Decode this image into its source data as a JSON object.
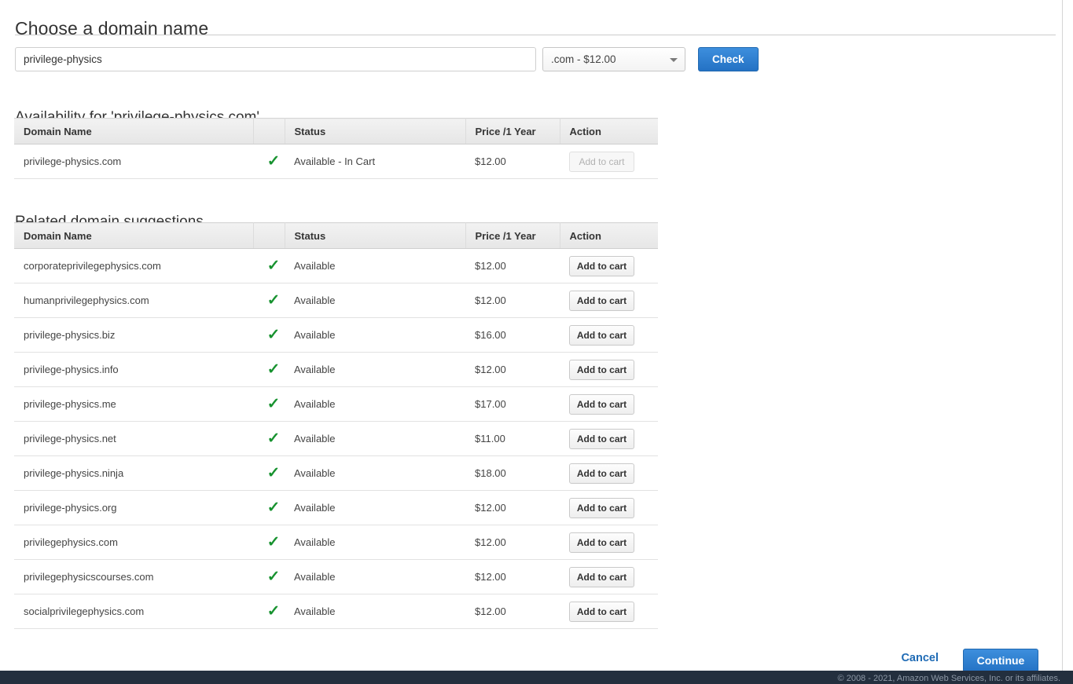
{
  "page": {
    "title": "Choose a domain name"
  },
  "search": {
    "input_value": "privilege-physics",
    "input_placeholder": "",
    "tld_selected": ".com - $12.00",
    "check_label": "Check"
  },
  "availability": {
    "title": "Availability for 'privilege-physics.com'",
    "columns": [
      "Domain Name",
      "",
      "Status",
      "Price /1 Year",
      "Action"
    ],
    "rows": [
      {
        "domain": "privilege-physics.com",
        "tick": "✓",
        "status": "Available - In Cart",
        "price": "$12.00",
        "action_label": "Add to cart",
        "action_disabled": true
      }
    ]
  },
  "suggestions": {
    "title": "Related domain suggestions",
    "columns": [
      "Domain Name",
      "",
      "Status",
      "Price /1 Year",
      "Action"
    ],
    "rows": [
      {
        "domain": "corporateprivilegephysics.com",
        "tick": "✓",
        "status": "Available",
        "price": "$12.00",
        "action_label": "Add to cart",
        "action_disabled": false
      },
      {
        "domain": "humanprivilegephysics.com",
        "tick": "✓",
        "status": "Available",
        "price": "$12.00",
        "action_label": "Add to cart",
        "action_disabled": false
      },
      {
        "domain": "privilege-physics.biz",
        "tick": "✓",
        "status": "Available",
        "price": "$16.00",
        "action_label": "Add to cart",
        "action_disabled": false
      },
      {
        "domain": "privilege-physics.info",
        "tick": "✓",
        "status": "Available",
        "price": "$12.00",
        "action_label": "Add to cart",
        "action_disabled": false
      },
      {
        "domain": "privilege-physics.me",
        "tick": "✓",
        "status": "Available",
        "price": "$17.00",
        "action_label": "Add to cart",
        "action_disabled": false
      },
      {
        "domain": "privilege-physics.net",
        "tick": "✓",
        "status": "Available",
        "price": "$11.00",
        "action_label": "Add to cart",
        "action_disabled": false
      },
      {
        "domain": "privilege-physics.ninja",
        "tick": "✓",
        "status": "Available",
        "price": "$18.00",
        "action_label": "Add to cart",
        "action_disabled": false
      },
      {
        "domain": "privilege-physics.org",
        "tick": "✓",
        "status": "Available",
        "price": "$12.00",
        "action_label": "Add to cart",
        "action_disabled": false
      },
      {
        "domain": "privilegephysics.com",
        "tick": "✓",
        "status": "Available",
        "price": "$12.00",
        "action_label": "Add to cart",
        "action_disabled": false
      },
      {
        "domain": "privilegephysicscourses.com",
        "tick": "✓",
        "status": "Available",
        "price": "$12.00",
        "action_label": "Add to cart",
        "action_disabled": false
      },
      {
        "domain": "socialprivilegephysics.com",
        "tick": "✓",
        "status": "Available",
        "price": "$12.00",
        "action_label": "Add to cart",
        "action_disabled": false
      }
    ]
  },
  "actions": {
    "cancel_label": "Cancel",
    "continue_label": "Continue"
  },
  "footer": {
    "copyright": "© 2008 - 2021, Amazon Web Services, Inc. or its affiliates."
  },
  "colors": {
    "primary_button": "#2472c4",
    "link": "#1f6bb5",
    "available_tick": "#17922f",
    "footer_bar": "#232f3e",
    "table_header": "#ececec"
  }
}
